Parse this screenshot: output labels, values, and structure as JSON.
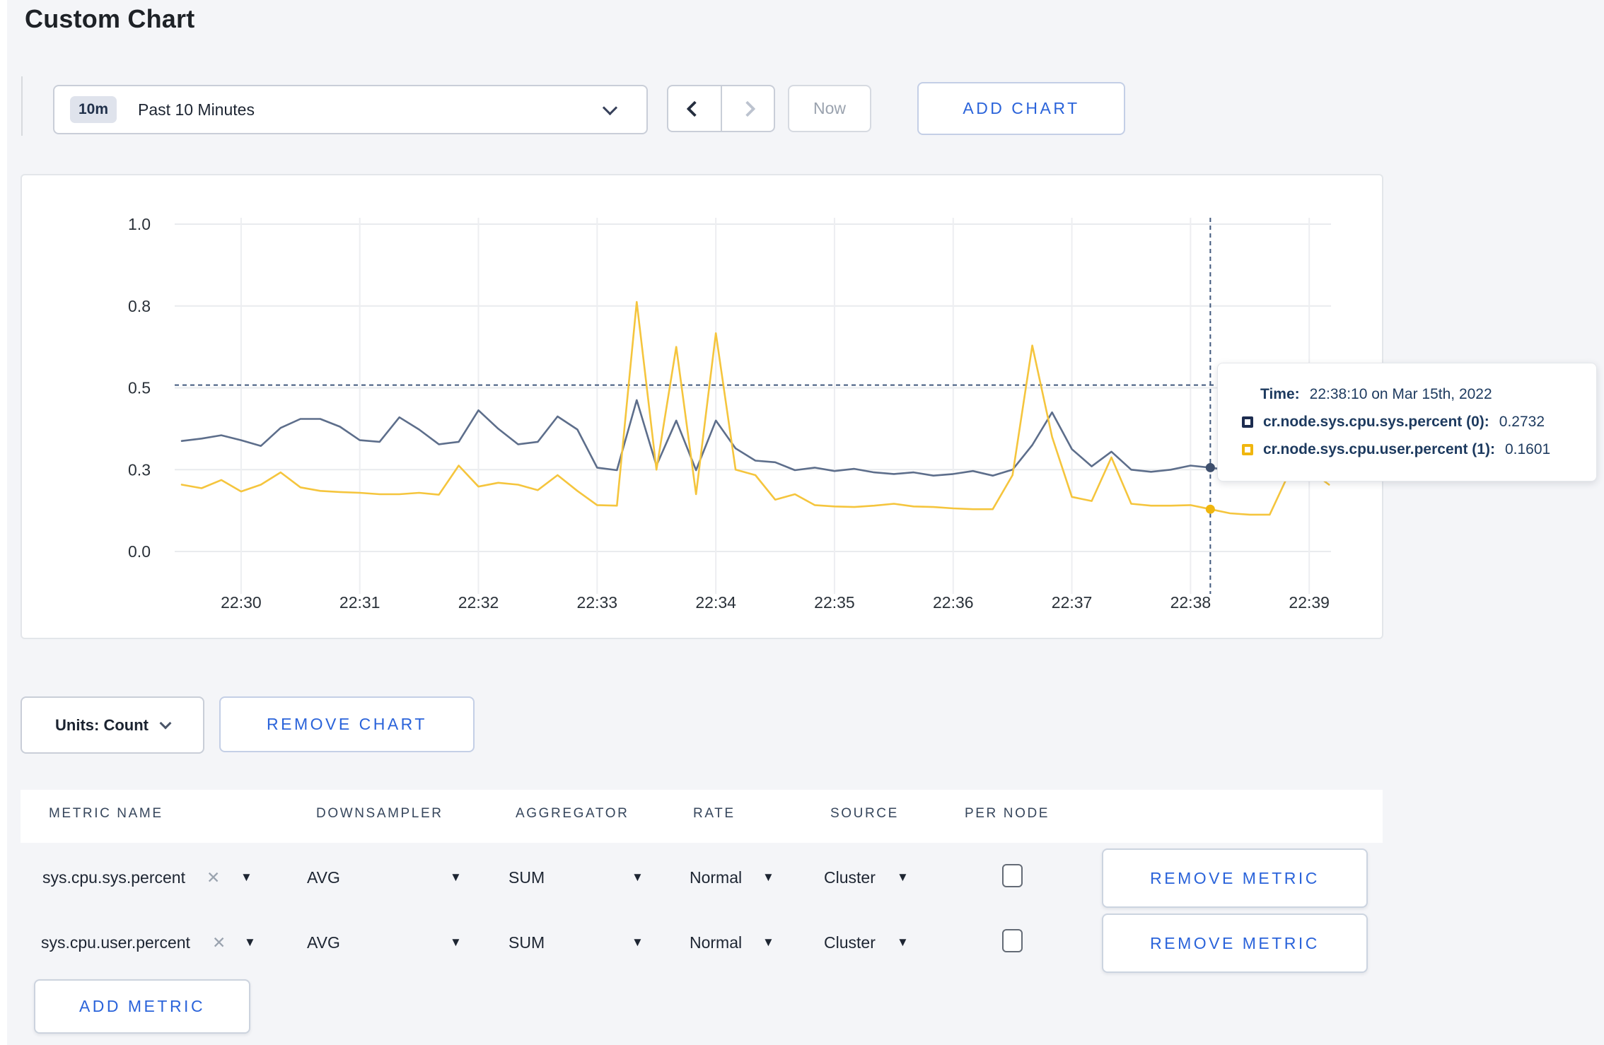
{
  "title": "Custom Chart",
  "toolbar": {
    "range_badge": "10m",
    "range_label": "Past 10 Minutes",
    "now_label": "Now",
    "add_chart_label": "ADD CHART"
  },
  "chart_actions": {
    "units_label": "Units: Count",
    "remove_chart_label": "REMOVE CHART"
  },
  "tooltip": {
    "time_label": "Time:",
    "time_value": "22:38:10 on Mar 15th, 2022",
    "series": [
      {
        "label": "cr.node.sys.cpu.sys.percent (0):",
        "value": "0.2732"
      },
      {
        "label": "cr.node.sys.cpu.user.percent (1):",
        "value": "0.1601"
      }
    ]
  },
  "metrics_table": {
    "headers": [
      "METRIC NAME",
      "DOWNSAMPLER",
      "AGGREGATOR",
      "RATE",
      "SOURCE",
      "PER NODE"
    ],
    "remove_metric_label": "REMOVE METRIC",
    "add_metric_label": "ADD METRIC",
    "rows": [
      {
        "metric_name": "sys.cpu.sys.percent",
        "downsampler": "AVG",
        "aggregator": "SUM",
        "rate": "Normal",
        "source": "Cluster",
        "per_node_checked": false
      },
      {
        "metric_name": "sys.cpu.user.percent",
        "downsampler": "AVG",
        "aggregator": "SUM",
        "rate": "Normal",
        "source": "Cluster",
        "per_node_checked": false
      }
    ]
  },
  "chart_data": {
    "type": "line",
    "title": "",
    "xlabel": "",
    "ylabel": "",
    "time_start": "22:29:30",
    "interval_seconds": 10,
    "x_tick_labels": [
      "22:30",
      "22:31",
      "22:32",
      "22:33",
      "22:34",
      "22:35",
      "22:36",
      "22:37",
      "22:38",
      "22:39"
    ],
    "y_tick_values": [
      0.0,
      0.3,
      0.5,
      0.8,
      1.0
    ],
    "y_tick_labels": [
      "0.0",
      "0.3",
      "0.5",
      "0.8",
      "1.0"
    ],
    "y_scale_note": "ticks evenly spaced (piecewise-linear axis)",
    "grid": true,
    "dashed_max_line_value": 0.51,
    "hover": {
      "index": 52,
      "time": "22:38:10"
    },
    "series": [
      {
        "name": "cr.node.sys.cpu.sys.percent (0)",
        "line_color": "#5d6e8b",
        "marker_color": "#3e4f6d",
        "values": [
          0.37,
          0.376,
          0.384,
          0.372,
          0.358,
          0.402,
          0.424,
          0.424,
          0.405,
          0.372,
          0.368,
          0.428,
          0.398,
          0.362,
          0.368,
          0.445,
          0.4,
          0.362,
          0.368,
          0.43,
          0.398,
          0.305,
          0.298,
          0.47,
          0.31,
          0.42,
          0.298,
          0.42,
          0.352,
          0.322,
          0.318,
          0.298,
          0.305,
          0.295,
          0.302,
          0.29,
          0.284,
          0.29,
          0.278,
          0.284,
          0.295,
          0.278,
          0.3,
          0.36,
          0.44,
          0.35,
          0.308,
          0.344,
          0.3,
          0.292,
          0.3,
          0.31,
          0.305,
          0.298,
          0.292,
          0.308,
          0.33,
          0.304,
          0.298
        ]
      },
      {
        "name": "cr.node.sys.cpu.user.percent (1)",
        "line_color": "#f5c53d",
        "marker_color": "#f0b60e",
        "values": [
          0.245,
          0.232,
          0.262,
          0.22,
          0.245,
          0.29,
          0.235,
          0.222,
          0.218,
          0.215,
          0.21,
          0.21,
          0.215,
          0.208,
          0.31,
          0.238,
          0.252,
          0.245,
          0.225,
          0.28,
          0.222,
          0.17,
          0.168,
          0.81,
          0.3,
          0.65,
          0.21,
          0.7,
          0.3,
          0.28,
          0.19,
          0.21,
          0.17,
          0.165,
          0.163,
          0.168,
          0.175,
          0.165,
          0.163,
          0.158,
          0.155,
          0.155,
          0.28,
          0.655,
          0.38,
          0.2,
          0.185,
          0.33,
          0.175,
          0.168,
          0.168,
          0.17,
          0.155,
          0.14,
          0.135,
          0.135,
          0.29,
          0.3,
          0.245
        ]
      }
    ]
  }
}
